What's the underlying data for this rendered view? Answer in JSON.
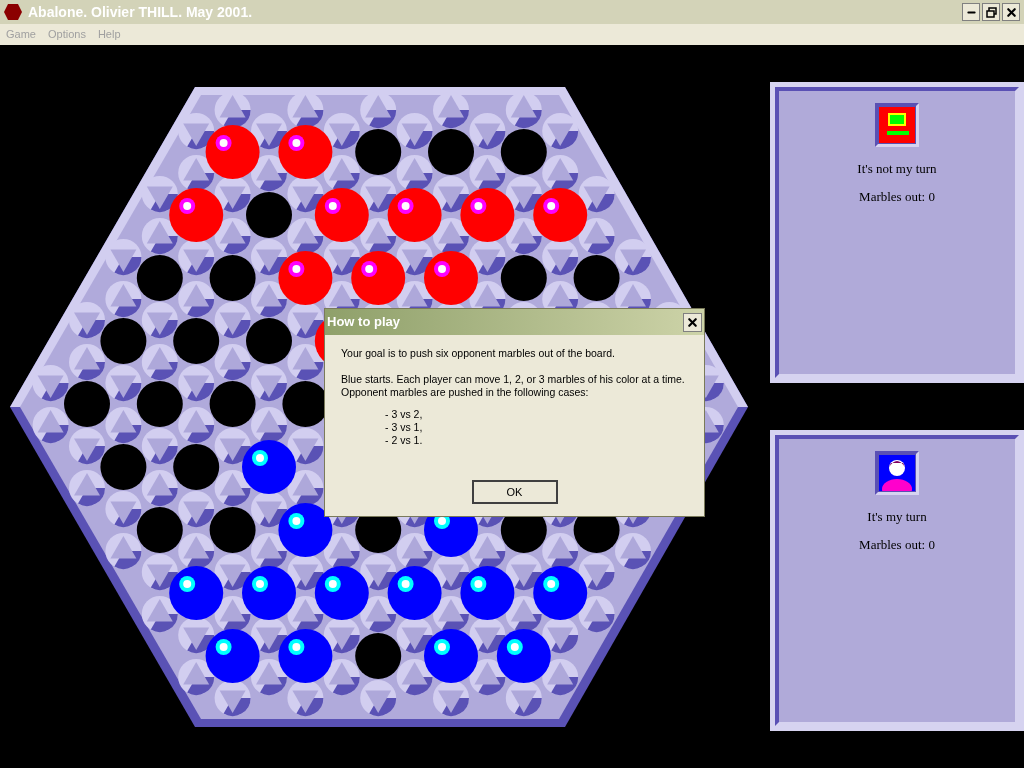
{
  "window": {
    "title": "Abalone. Olivier THILL. May 2001."
  },
  "menu": [
    {
      "label": "Game",
      "disabled": true
    },
    {
      "label": "Options",
      "disabled": true
    },
    {
      "label": "Help",
      "disabled": true
    }
  ],
  "board": {
    "rows": [
      [
        {
          "kind": "marble",
          "color": "#ff0000"
        },
        {
          "kind": "marble",
          "color": "#ff0000"
        },
        {
          "kind": "empty"
        },
        {
          "kind": "empty"
        },
        {
          "kind": "empty"
        }
      ],
      [
        {
          "kind": "marble",
          "color": "#ff0000"
        },
        {
          "kind": "empty"
        },
        {
          "kind": "marble",
          "color": "#ff0000"
        },
        {
          "kind": "marble",
          "color": "#ff0000"
        },
        {
          "kind": "marble",
          "color": "#ff0000"
        },
        {
          "kind": "marble",
          "color": "#ff0000"
        }
      ],
      [
        {
          "kind": "empty"
        },
        {
          "kind": "empty"
        },
        {
          "kind": "marble",
          "color": "#ff0000"
        },
        {
          "kind": "marble",
          "color": "#ff0000"
        },
        {
          "kind": "marble",
          "color": "#ff0000"
        },
        {
          "kind": "empty"
        },
        {
          "kind": "empty"
        }
      ],
      [
        {
          "kind": "empty"
        },
        {
          "kind": "empty"
        },
        {
          "kind": "empty"
        },
        {
          "kind": "marble",
          "color": "#ff0000"
        },
        null,
        null,
        null,
        null
      ],
      [
        {
          "kind": "empty"
        },
        {
          "kind": "empty"
        },
        {
          "kind": "empty"
        },
        {
          "kind": "empty"
        },
        null,
        null,
        null,
        null,
        null
      ],
      [
        {
          "kind": "empty"
        },
        {
          "kind": "empty"
        },
        {
          "kind": "marble",
          "color": "#0000ff"
        },
        null,
        null,
        null,
        null,
        null
      ],
      [
        {
          "kind": "empty"
        },
        {
          "kind": "empty"
        },
        {
          "kind": "marble",
          "color": "#0000ff"
        },
        {
          "kind": "empty"
        },
        {
          "kind": "marble",
          "color": "#0000ff"
        },
        {
          "kind": "empty"
        },
        {
          "kind": "empty"
        }
      ],
      [
        {
          "kind": "marble",
          "color": "#0000ff"
        },
        {
          "kind": "marble",
          "color": "#0000ff"
        },
        {
          "kind": "marble",
          "color": "#0000ff"
        },
        {
          "kind": "marble",
          "color": "#0000ff"
        },
        {
          "kind": "marble",
          "color": "#0000ff"
        },
        {
          "kind": "marble",
          "color": "#0000ff"
        }
      ],
      [
        {
          "kind": "marble",
          "color": "#0000ff"
        },
        {
          "kind": "marble",
          "color": "#0000ff"
        },
        {
          "kind": "empty"
        },
        {
          "kind": "marble",
          "color": "#0000ff"
        },
        {
          "kind": "marble",
          "color": "#0000ff"
        }
      ]
    ]
  },
  "players": [
    {
      "kind": "computer",
      "status": "It's not my turn",
      "score": "Marbles out: 0"
    },
    {
      "kind": "human",
      "status": "It's my turn",
      "score": "Marbles out: 0"
    }
  ],
  "dialog": {
    "title": "How to play",
    "paragraphs": [
      "Your goal is to push six opponent marbles out of the board.",
      "Blue starts. Each player can move 1, 2, or 3 marbles of his color at a time. Opponent marbles are pushed in the following cases:"
    ],
    "cases": [
      "- 3 vs 2,",
      "- 3 vs 1,",
      "- 2 vs 1."
    ],
    "button": "OK"
  }
}
